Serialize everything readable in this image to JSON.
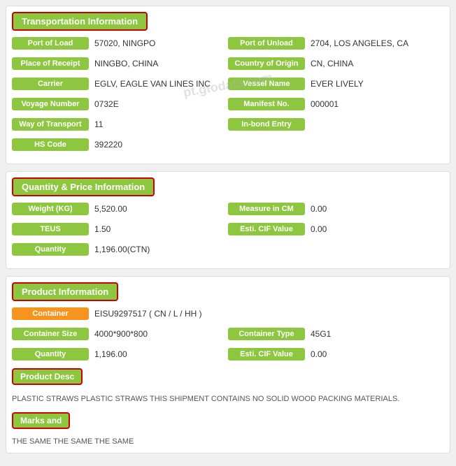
{
  "transportation": {
    "header": "Transportation Information",
    "fields": {
      "port_of_load_label": "Port of Load",
      "port_of_load_value": "57020, NINGPO",
      "port_of_unload_label": "Port of Unload",
      "port_of_unload_value": "2704, LOS ANGELES, CA",
      "place_of_receipt_label": "Place of Receipt",
      "place_of_receipt_value": "NINGBO, CHINA",
      "country_of_origin_label": "Country of Origin",
      "country_of_origin_value": "CN, CHINA",
      "carrier_label": "Carrier",
      "carrier_value": "EGLV, EAGLE VAN LINES INC",
      "vessel_name_label": "Vessel Name",
      "vessel_name_value": "EVER LIVELY",
      "voyage_number_label": "Voyage Number",
      "voyage_number_value": "0732E",
      "manifest_no_label": "Manifest No.",
      "manifest_no_value": "000001",
      "way_of_transport_label": "Way of Transport",
      "way_of_transport_value": "11",
      "in_bond_entry_label": "In-bond Entry",
      "in_bond_entry_value": "",
      "hs_code_label": "HS Code",
      "hs_code_value": "392220"
    }
  },
  "quantity": {
    "header": "Quantity & Price Information",
    "fields": {
      "weight_label": "Weight (KG)",
      "weight_value": "5,520.00",
      "measure_label": "Measure in CM",
      "measure_value": "0.00",
      "teus_label": "TEUS",
      "teus_value": "1.50",
      "esti_cif_label": "Esti. CIF Value",
      "esti_cif_value": "0.00",
      "quantity_label": "Quantity",
      "quantity_value": "1,196.00(CTN)"
    }
  },
  "product": {
    "header": "Product Information",
    "container_label": "Container",
    "container_value": "EISU9297517 ( CN / L / HH )",
    "container_size_label": "Container Size",
    "container_size_value": "4000*900*800",
    "container_type_label": "Container Type",
    "container_type_value": "45G1",
    "quantity_label": "Quantity",
    "quantity_value": "1,196.00",
    "esti_cif_label": "Esti. CIF Value",
    "esti_cif_value": "0.00",
    "product_desc_header": "Product Desc",
    "product_desc_text": "PLASTIC STRAWS PLASTIC STRAWS THIS SHIPMENT CONTAINS NO SOLID WOOD PACKING MATERIALS.",
    "marks_header": "Marks and",
    "marks_text": "THE SAME THE SAME THE SAME"
  },
  "watermark": "pt.gtodata.com"
}
